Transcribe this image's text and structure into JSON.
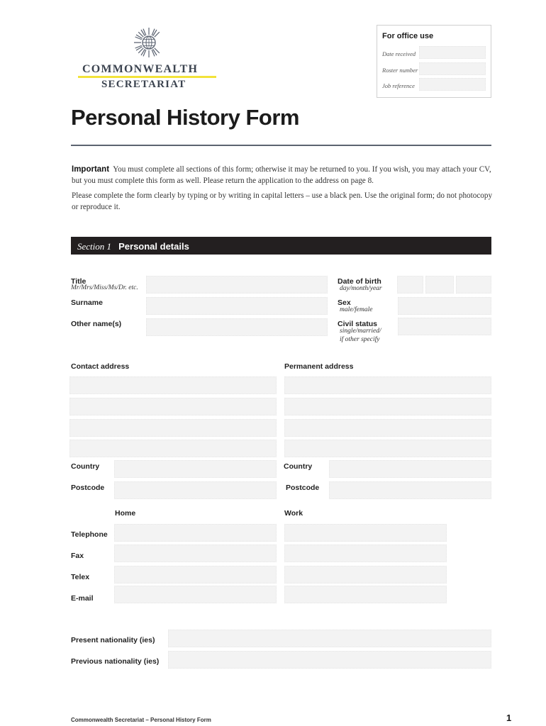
{
  "logo": {
    "icon": "commonwealth-globe-emblem",
    "line1": "COMMONWEALTH",
    "line2": "SECRETARIAT",
    "accent_color": "#f2e33a",
    "text_color": "#3c4450"
  },
  "office_use": {
    "title": "For office use",
    "fields": [
      {
        "label": "Date received",
        "value": ""
      },
      {
        "label": "Roster number",
        "value": ""
      },
      {
        "label": "Job reference",
        "value": ""
      }
    ]
  },
  "header": {
    "title": "Personal History Form"
  },
  "intro": {
    "important_label": "Important",
    "paragraph1": "You must complete all sections of this form; otherwise it may be returned to you.  If you wish, you may attach your CV, but you must complete this form as well.  Please return the application to the address on page 8.",
    "paragraph2": "Please complete the form clearly by typing or by writing in capital letters – use a black pen.  Use the original form; do not photocopy or reproduce it."
  },
  "section": {
    "number": "Section 1",
    "name": "Personal details",
    "bar_color": "#231f20"
  },
  "personal": {
    "title": {
      "label": "Title",
      "hint": "Mr/Mrs/Miss/Ms/Dr. etc.",
      "value": ""
    },
    "surname": {
      "label": "Surname",
      "value": ""
    },
    "other_names": {
      "label": "Other name(s)",
      "value": ""
    },
    "dob": {
      "label": "Date of birth",
      "hint": "day/month/year",
      "day": "",
      "month": "",
      "year": ""
    },
    "sex": {
      "label": "Sex",
      "hint": "male/female",
      "value": ""
    },
    "civil_status": {
      "label": "Civil status",
      "hint1": "single/married/",
      "hint2": "if other specify",
      "value": ""
    }
  },
  "address": {
    "contact_label": "Contact address",
    "permanent_label": "Permanent address",
    "contact_lines": [
      "",
      "",
      "",
      ""
    ],
    "permanent_lines": [
      "",
      "",
      "",
      ""
    ],
    "country_label": "Country",
    "postcode_label": "Postcode",
    "contact_country": "",
    "contact_postcode": "",
    "permanent_country": "",
    "permanent_postcode": ""
  },
  "contact": {
    "home_label": "Home",
    "work_label": "Work",
    "rows": [
      {
        "label": "Telephone",
        "home": "",
        "work": ""
      },
      {
        "label": "Fax",
        "home": "",
        "work": ""
      },
      {
        "label": "Telex",
        "home": "",
        "work": ""
      },
      {
        "label": "E-mail",
        "home": "",
        "work": ""
      }
    ]
  },
  "nationality": {
    "present_label": "Present nationality (ies)",
    "previous_label": "Previous nationality (ies)",
    "present": "",
    "previous": ""
  },
  "footer": {
    "text": "Commonwealth Secretariat – Personal History Form",
    "page_number": "1"
  }
}
